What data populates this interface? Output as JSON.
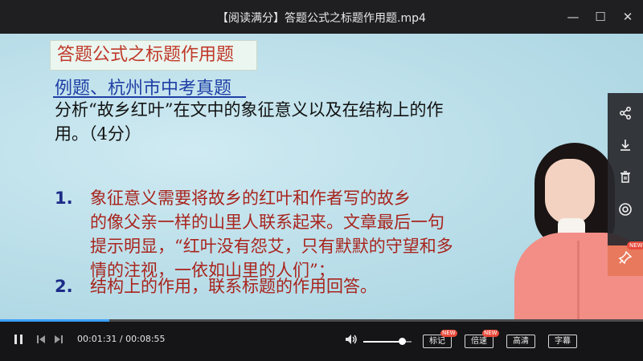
{
  "window": {
    "title": "【阅读满分】答题公式之标题作用题.mp4",
    "minimize_label": "—",
    "maximize_label": "☐",
    "close_label": "✕"
  },
  "slide": {
    "title": "答题公式之标题作用题",
    "example": "例题、杭州市中考真题",
    "question": "分析“故乡红叶”在文中的象征意义以及在结构上的作用。（4分）",
    "answers": [
      {
        "num": "1.",
        "first": "象征意义需要将故乡的红叶和作者写的故乡",
        "rest": "的像父亲一样的山里人联系起来。文章最后一句提示明显，“红叶没有怨艾，只有默默的守望和多情的注视，一依如山里的人们”；"
      },
      {
        "num": "2.",
        "first": "结构上的作用，联系标题的作用回答。"
      }
    ]
  },
  "side_panel": {
    "share_icon": "share-icon",
    "download_icon": "download-icon",
    "delete_icon": "trash-icon",
    "record_icon": "record-icon",
    "pin_icon": "pin-icon",
    "new_label": "NEW"
  },
  "player": {
    "current_time": "00:01:31",
    "duration": "00:08:55",
    "separator": "/",
    "progress": 0.17,
    "volume": 0.8,
    "buttons": {
      "mark": "标记",
      "speed": "倍速",
      "quality": "高清",
      "subtitle": "字幕"
    },
    "mark_badge": "NEW",
    "speed_badge": "NEW"
  },
  "colors": {
    "accent": "#3aa0ff",
    "pin_button": "#e9795c",
    "slide_title": "#c0392b",
    "example_text": "#1f3fa6",
    "answer_text": "#a8241d"
  }
}
